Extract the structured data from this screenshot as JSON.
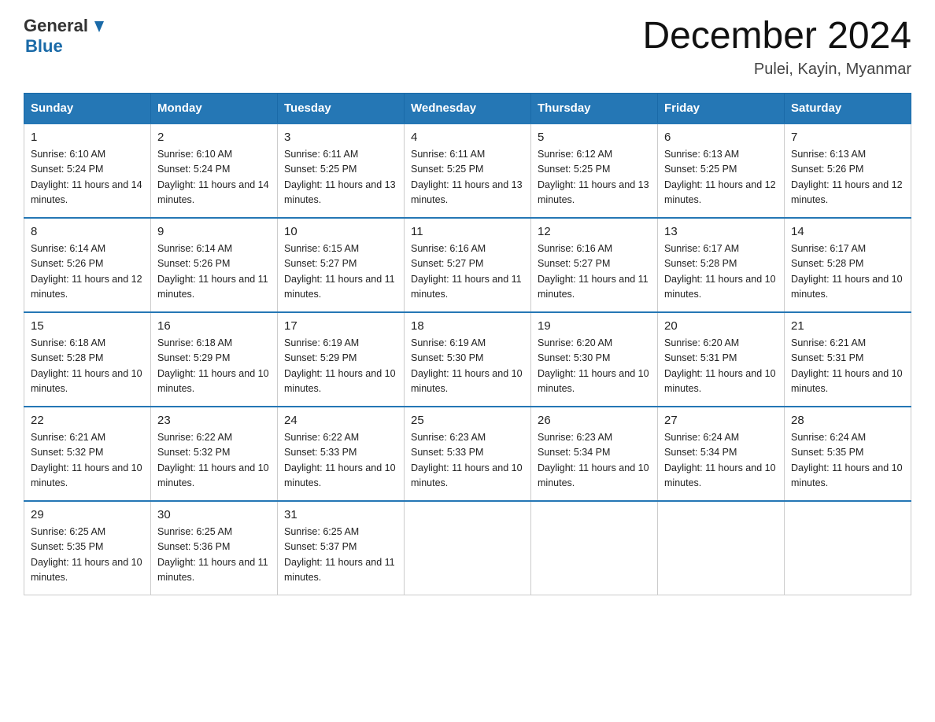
{
  "header": {
    "logo_general": "General",
    "logo_blue": "Blue",
    "month_year": "December 2024",
    "location": "Pulei, Kayin, Myanmar"
  },
  "days_of_week": [
    "Sunday",
    "Monday",
    "Tuesday",
    "Wednesday",
    "Thursday",
    "Friday",
    "Saturday"
  ],
  "weeks": [
    [
      {
        "day": "1",
        "sunrise": "6:10 AM",
        "sunset": "5:24 PM",
        "daylight": "11 hours and 14 minutes."
      },
      {
        "day": "2",
        "sunrise": "6:10 AM",
        "sunset": "5:24 PM",
        "daylight": "11 hours and 14 minutes."
      },
      {
        "day": "3",
        "sunrise": "6:11 AM",
        "sunset": "5:25 PM",
        "daylight": "11 hours and 13 minutes."
      },
      {
        "day": "4",
        "sunrise": "6:11 AM",
        "sunset": "5:25 PM",
        "daylight": "11 hours and 13 minutes."
      },
      {
        "day": "5",
        "sunrise": "6:12 AM",
        "sunset": "5:25 PM",
        "daylight": "11 hours and 13 minutes."
      },
      {
        "day": "6",
        "sunrise": "6:13 AM",
        "sunset": "5:25 PM",
        "daylight": "11 hours and 12 minutes."
      },
      {
        "day": "7",
        "sunrise": "6:13 AM",
        "sunset": "5:26 PM",
        "daylight": "11 hours and 12 minutes."
      }
    ],
    [
      {
        "day": "8",
        "sunrise": "6:14 AM",
        "sunset": "5:26 PM",
        "daylight": "11 hours and 12 minutes."
      },
      {
        "day": "9",
        "sunrise": "6:14 AM",
        "sunset": "5:26 PM",
        "daylight": "11 hours and 11 minutes."
      },
      {
        "day": "10",
        "sunrise": "6:15 AM",
        "sunset": "5:27 PM",
        "daylight": "11 hours and 11 minutes."
      },
      {
        "day": "11",
        "sunrise": "6:16 AM",
        "sunset": "5:27 PM",
        "daylight": "11 hours and 11 minutes."
      },
      {
        "day": "12",
        "sunrise": "6:16 AM",
        "sunset": "5:27 PM",
        "daylight": "11 hours and 11 minutes."
      },
      {
        "day": "13",
        "sunrise": "6:17 AM",
        "sunset": "5:28 PM",
        "daylight": "11 hours and 10 minutes."
      },
      {
        "day": "14",
        "sunrise": "6:17 AM",
        "sunset": "5:28 PM",
        "daylight": "11 hours and 10 minutes."
      }
    ],
    [
      {
        "day": "15",
        "sunrise": "6:18 AM",
        "sunset": "5:28 PM",
        "daylight": "11 hours and 10 minutes."
      },
      {
        "day": "16",
        "sunrise": "6:18 AM",
        "sunset": "5:29 PM",
        "daylight": "11 hours and 10 minutes."
      },
      {
        "day": "17",
        "sunrise": "6:19 AM",
        "sunset": "5:29 PM",
        "daylight": "11 hours and 10 minutes."
      },
      {
        "day": "18",
        "sunrise": "6:19 AM",
        "sunset": "5:30 PM",
        "daylight": "11 hours and 10 minutes."
      },
      {
        "day": "19",
        "sunrise": "6:20 AM",
        "sunset": "5:30 PM",
        "daylight": "11 hours and 10 minutes."
      },
      {
        "day": "20",
        "sunrise": "6:20 AM",
        "sunset": "5:31 PM",
        "daylight": "11 hours and 10 minutes."
      },
      {
        "day": "21",
        "sunrise": "6:21 AM",
        "sunset": "5:31 PM",
        "daylight": "11 hours and 10 minutes."
      }
    ],
    [
      {
        "day": "22",
        "sunrise": "6:21 AM",
        "sunset": "5:32 PM",
        "daylight": "11 hours and 10 minutes."
      },
      {
        "day": "23",
        "sunrise": "6:22 AM",
        "sunset": "5:32 PM",
        "daylight": "11 hours and 10 minutes."
      },
      {
        "day": "24",
        "sunrise": "6:22 AM",
        "sunset": "5:33 PM",
        "daylight": "11 hours and 10 minutes."
      },
      {
        "day": "25",
        "sunrise": "6:23 AM",
        "sunset": "5:33 PM",
        "daylight": "11 hours and 10 minutes."
      },
      {
        "day": "26",
        "sunrise": "6:23 AM",
        "sunset": "5:34 PM",
        "daylight": "11 hours and 10 minutes."
      },
      {
        "day": "27",
        "sunrise": "6:24 AM",
        "sunset": "5:34 PM",
        "daylight": "11 hours and 10 minutes."
      },
      {
        "day": "28",
        "sunrise": "6:24 AM",
        "sunset": "5:35 PM",
        "daylight": "11 hours and 10 minutes."
      }
    ],
    [
      {
        "day": "29",
        "sunrise": "6:25 AM",
        "sunset": "5:35 PM",
        "daylight": "11 hours and 10 minutes."
      },
      {
        "day": "30",
        "sunrise": "6:25 AM",
        "sunset": "5:36 PM",
        "daylight": "11 hours and 11 minutes."
      },
      {
        "day": "31",
        "sunrise": "6:25 AM",
        "sunset": "5:37 PM",
        "daylight": "11 hours and 11 minutes."
      },
      null,
      null,
      null,
      null
    ]
  ]
}
